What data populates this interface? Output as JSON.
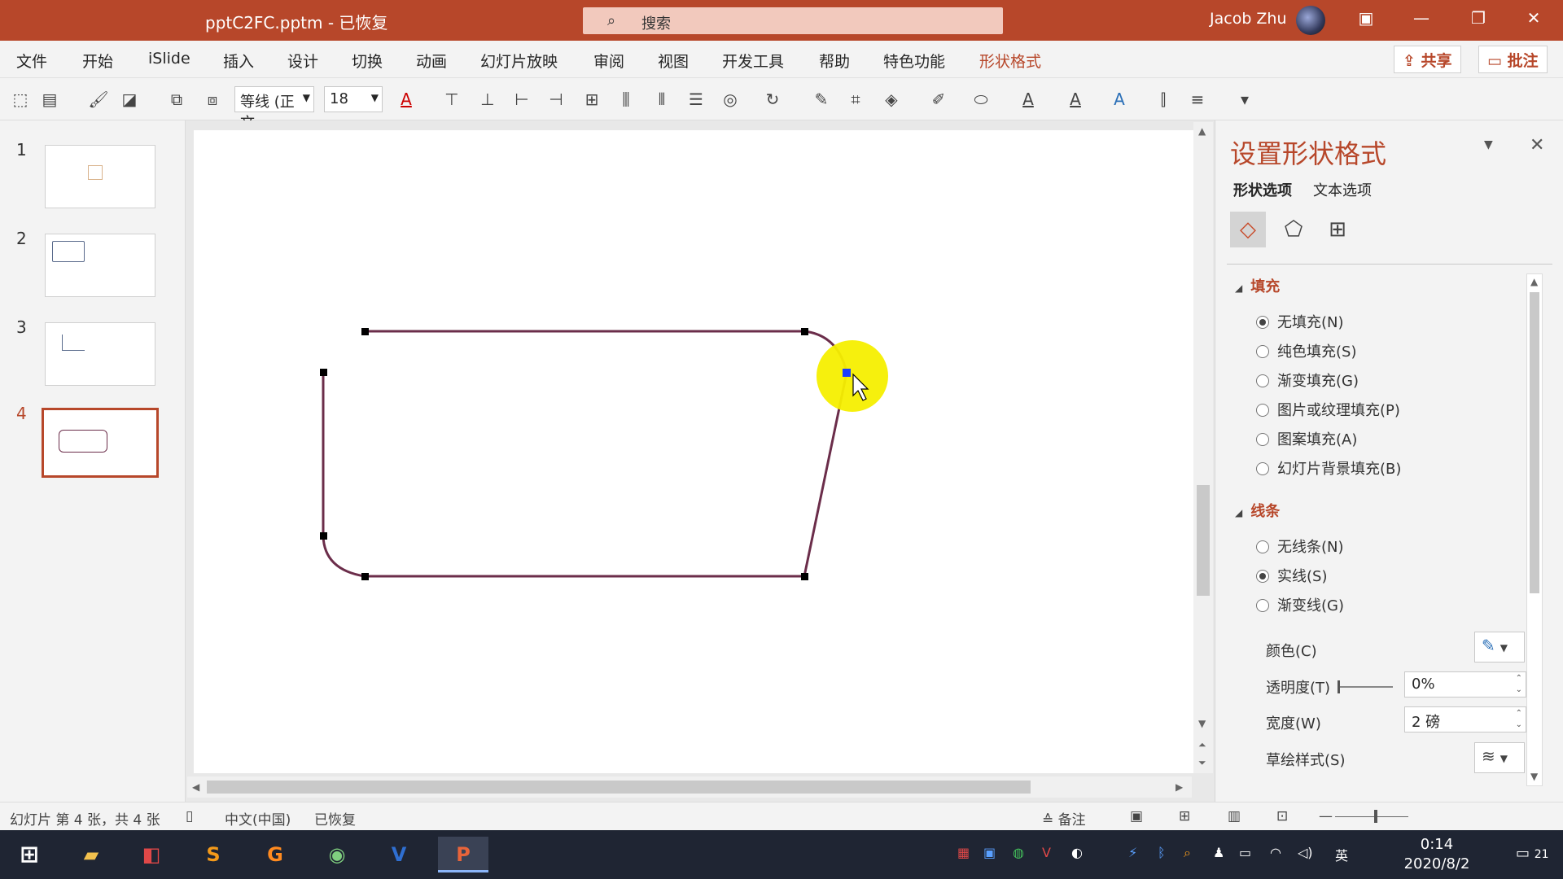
{
  "titlebar": {
    "doc_title": "pptC2FC.pptm  -  已恢复",
    "search_placeholder": "搜索",
    "user_name": "Jacob Zhu",
    "ribbon_options_glyph": "▣",
    "minimize_glyph": "—",
    "restore_glyph": "❐",
    "close_glyph": "✕"
  },
  "menu": {
    "items": [
      "文件",
      "开始",
      "iSlide",
      "插入",
      "设计",
      "切换",
      "动画",
      "幻灯片放映",
      "审阅",
      "视图",
      "开发工具",
      "帮助",
      "特色功能",
      "形状格式"
    ],
    "active": "形状格式",
    "share_label": "共享",
    "comment_label": "批注"
  },
  "toolbar": {
    "font_name": "等线 (正文",
    "font_size": "18"
  },
  "thumbnails": [
    {
      "number": "1"
    },
    {
      "number": "2"
    },
    {
      "number": "3"
    },
    {
      "number": "4"
    }
  ],
  "format_pane": {
    "title": "设置形状格式",
    "tabs": [
      "形状选项",
      "文本选项"
    ],
    "fill_section": "填充",
    "fill_options": [
      "无填充(N)",
      "纯色填充(S)",
      "渐变填充(G)",
      "图片或纹理填充(P)",
      "图案填充(A)",
      "幻灯片背景填充(B)"
    ],
    "fill_selected": 0,
    "line_section": "线条",
    "line_options": [
      "无线条(N)",
      "实线(S)",
      "渐变线(G)"
    ],
    "line_selected": 1,
    "color_label": "颜色(C)",
    "transparency_label": "透明度(T)",
    "transparency_value": "0%",
    "width_label": "宽度(W)",
    "width_value": "2 磅",
    "sketch_label": "草绘样式(S)"
  },
  "statusbar": {
    "slide_info": "幻灯片 第 4 张，共 4 张",
    "language": "中文(中国)",
    "recovered": "已恢复",
    "notes": "备注"
  },
  "taskbar": {
    "time": "0:14",
    "date": "2020/8/2",
    "ime": "英",
    "notification_count": "21"
  },
  "colors": {
    "accent": "#b7472a",
    "shape_stroke": "#6b2d4a",
    "highlight": "#f6ef00"
  }
}
